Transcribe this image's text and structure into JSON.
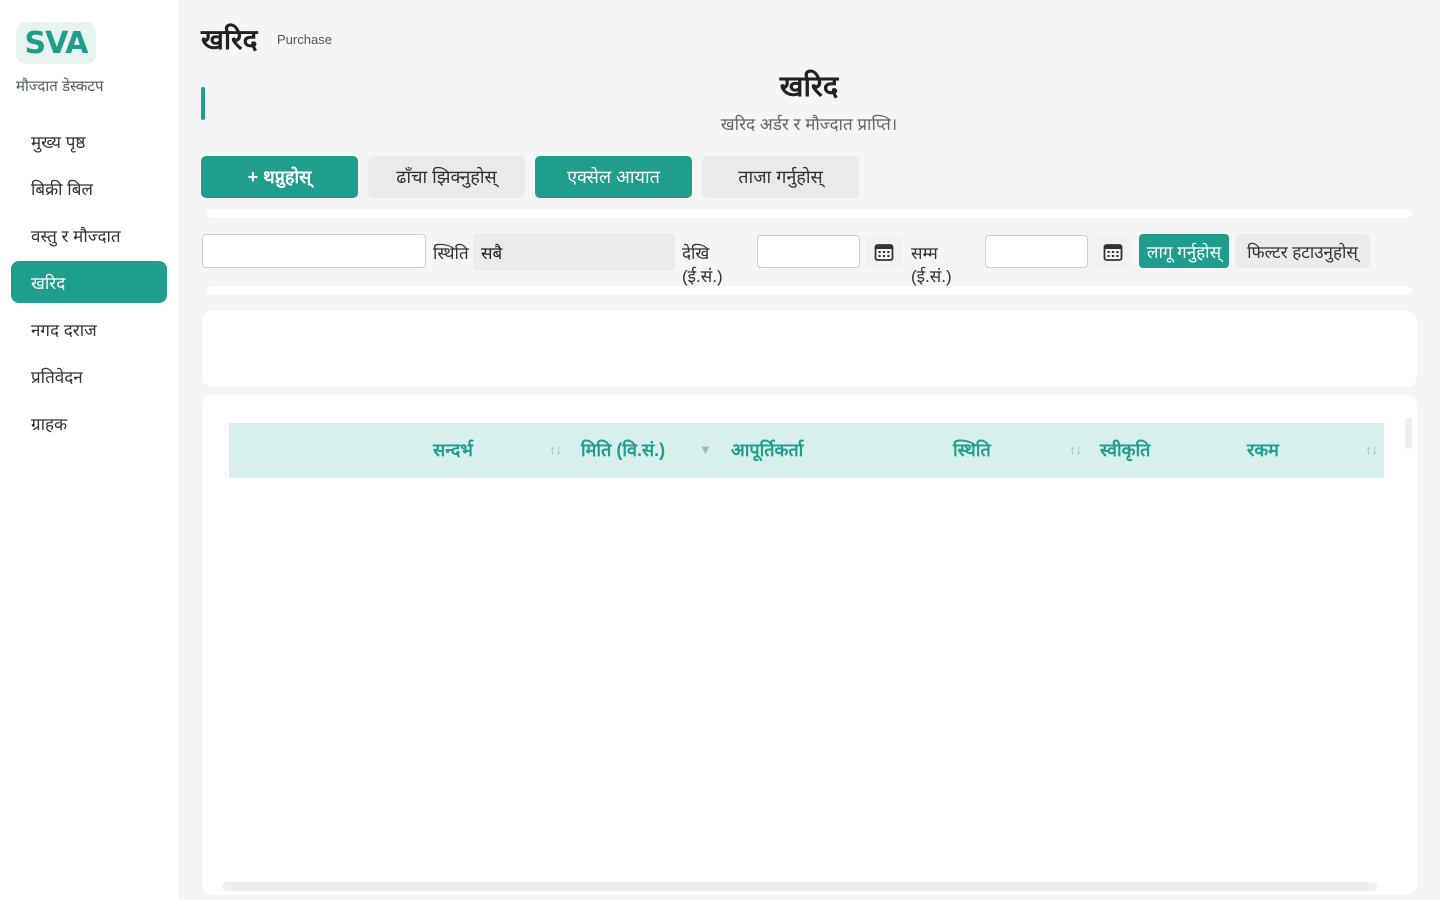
{
  "sidebar": {
    "logo_text": "SVA",
    "app_name": "मौज्दात डेस्कटप",
    "items": [
      {
        "label": "मुख्य पृष्ठ"
      },
      {
        "label": "बिक्री बिल"
      },
      {
        "label": "वस्तु र मौज्दात"
      },
      {
        "label": "खरिद"
      },
      {
        "label": "नगद दराज"
      },
      {
        "label": "प्रतिवेदन"
      },
      {
        "label": "ग्राहक"
      }
    ],
    "active_item": "खरिद"
  },
  "header": {
    "title": "खरिद",
    "subtitle": "Purchase"
  },
  "hero": {
    "title": "खरिद",
    "subtitle": "खरिद अर्डर र मौज्दात प्राप्ति।"
  },
  "actions": {
    "add": "+ थप्नुहोस्",
    "template": "ढाँचा झिक्नुहोस्",
    "excel_import": "एक्सेल आयात",
    "refresh": "ताजा गर्नुहोस्"
  },
  "filters": {
    "search_value": "",
    "status_label": "स्थिति",
    "status_value": "सबै",
    "from_label": "देखि (ई.सं.)",
    "from_value": "",
    "to_label": "सम्म (ई.सं.)",
    "to_value": "",
    "apply": "लागू गर्नुहोस्",
    "clear": "फिल्टर हटाउनुहोस्"
  },
  "table": {
    "columns": [
      "सन्दर्भ",
      "मिति (वि.सं.)",
      "आपूर्तिकर्ता",
      "स्थिति",
      "स्वीकृति",
      "रकम"
    ],
    "sort_icons": [
      "↑↓",
      "▼",
      "↑↓",
      "↑↓"
    ],
    "rows": []
  },
  "colors": {
    "accent": "#1f9e8e",
    "header_bg": "#d8f0ec",
    "secondary_btn": "#e8ebea",
    "page_bg": "#f4f5f4"
  }
}
